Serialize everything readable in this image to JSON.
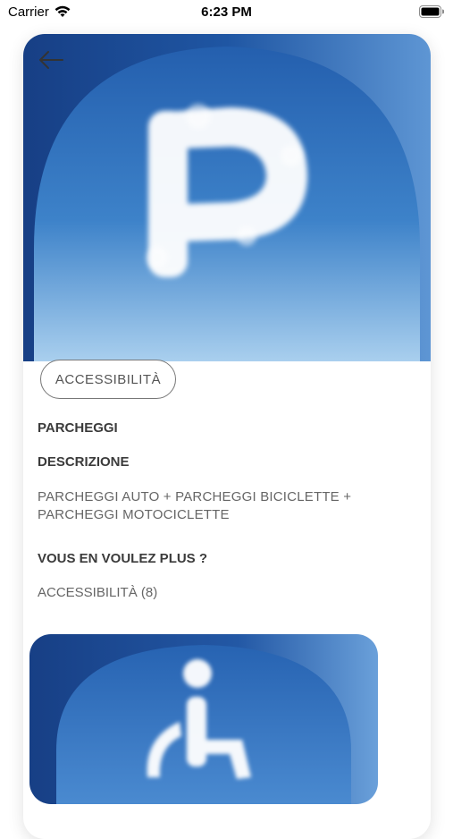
{
  "status_bar": {
    "carrier": "Carrier",
    "time": "6:23 PM"
  },
  "detail": {
    "tag_label": "ACCESSIBILITÀ",
    "title": "PARCHEGGI",
    "description_heading": "DESCRIZIONE",
    "description": "PARCHEGGI AUTO + PARCHEGGI BICICLETTE + PARCHEGGI MOTOCICLETTE",
    "more_heading": "VOUS EN VOULEZ PLUS ?",
    "more_link": "ACCESSIBILITÀ (8)"
  },
  "icons": {
    "back": "arrow-left-icon",
    "hero": "parking-p-cloud",
    "related": "wheelchair-symbol"
  },
  "colors": {
    "sky_top": "#2f6fb8",
    "sky_bottom": "#a8cdec",
    "arch": "#1e4f98"
  }
}
